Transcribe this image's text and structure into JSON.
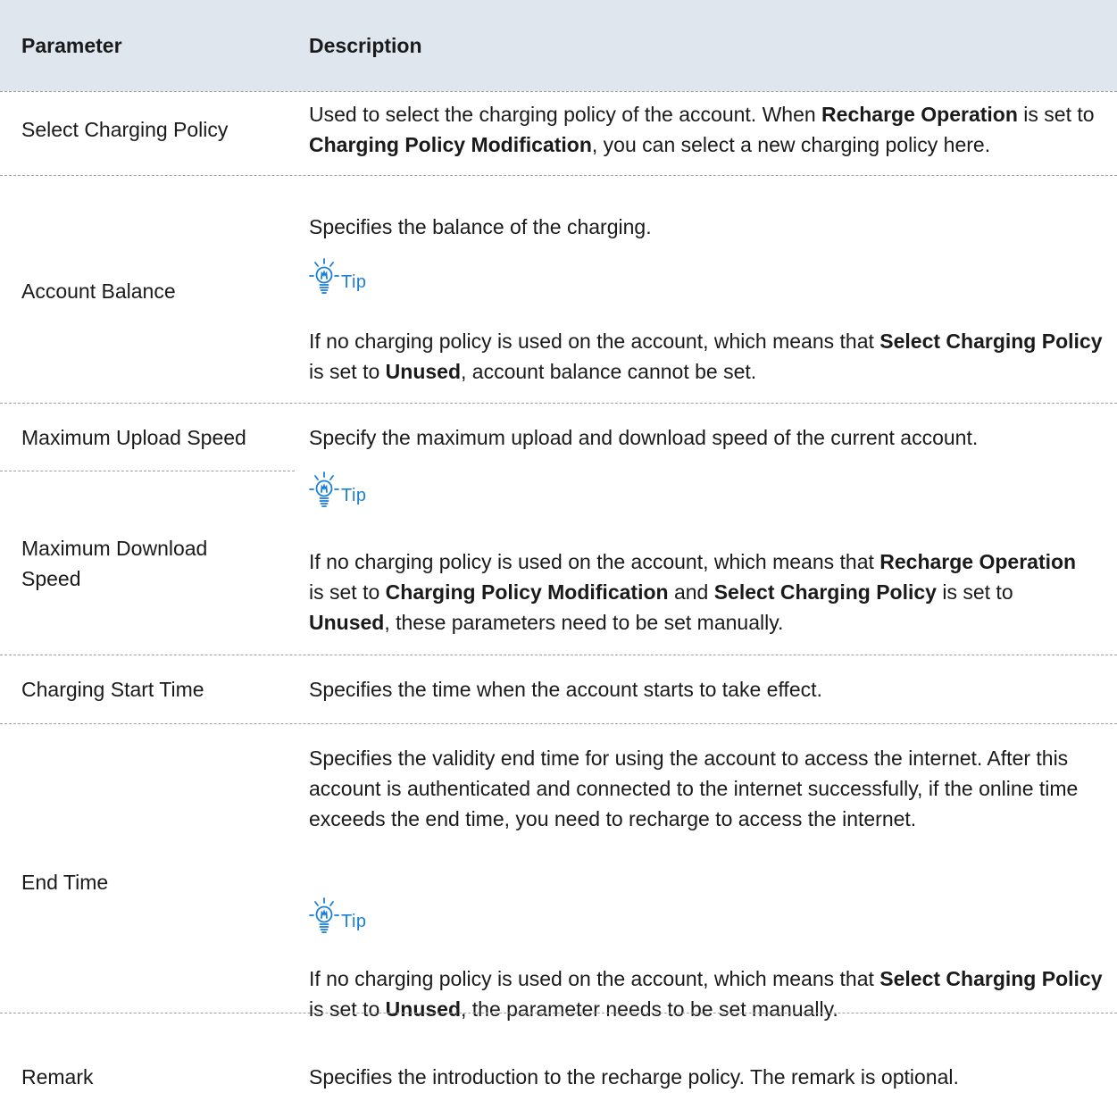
{
  "table": {
    "headers": {
      "parameter": "Parameter",
      "description": "Description"
    },
    "tip_label": "Tip",
    "rows": {
      "select_charging_policy": {
        "param": "Select Charging Policy",
        "desc_html": "Used to select the charging policy of the account. When <b>Recharge Operation</b> is set to <b>Charging Policy Modification</b>, you can select a new charging policy here."
      },
      "account_balance": {
        "param": "Account Balance",
        "desc": "Specifies the balance of the charging.",
        "tip_html": "If no charging policy is used on the account, which means that <b>Select Charging Policy</b> is set to <b>Unused</b>, account balance cannot be set."
      },
      "max_upload_speed": {
        "param": "Maximum Upload Speed"
      },
      "max_download_speed": {
        "param": "Maximum Download Speed"
      },
      "speed_group": {
        "desc": "Specify the maximum upload and download speed of the current account.",
        "tip_html": "If no charging policy is used on the account, which means that <b>Recharge Operation</b> is set to <b>Charging Policy Modification</b> and <b>Select Charging Policy</b> is set to <b>Unused</b>, these parameters need to be set manually."
      },
      "charging_start_time": {
        "param": "Charging Start Time",
        "desc": "Specifies the time when the account starts to take effect."
      },
      "end_time": {
        "param": "End Time",
        "desc": "Specifies the validity end time for using the account to access the internet. After this account is authenticated and connected to the internet successfully, if the online time exceeds the end time, you need to recharge to access the internet.",
        "tip_html": "If no charging policy is used on the account, which means that <b>Select Charging Policy</b> is set to <b>Unused</b>, the parameter needs to be set manually."
      },
      "remark": {
        "param": "Remark",
        "desc": "Specifies the introduction to the recharge policy. The remark is optional."
      }
    }
  },
  "colors": {
    "header_bg": "#dfe6ee",
    "tip_blue": "#1a7fd6",
    "divider": "#9aa0a6"
  },
  "icons": {
    "tip": "lightbulb-icon"
  }
}
